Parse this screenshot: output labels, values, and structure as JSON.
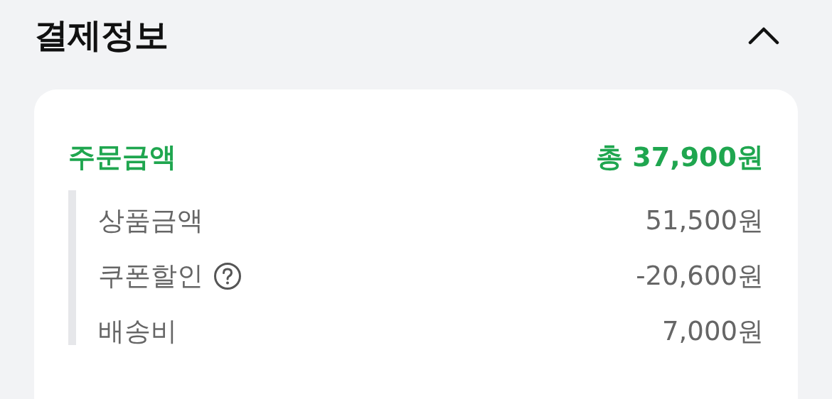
{
  "section": {
    "title": "결제정보",
    "expanded": true
  },
  "order": {
    "label": "주문금액",
    "total": "총 37,900원",
    "items": [
      {
        "label": "상품금액",
        "value": "51,500원",
        "help": false
      },
      {
        "label": "쿠폰할인",
        "value": "-20,600원",
        "help": true
      },
      {
        "label": "배송비",
        "value": "7,000원",
        "help": false
      }
    ]
  }
}
